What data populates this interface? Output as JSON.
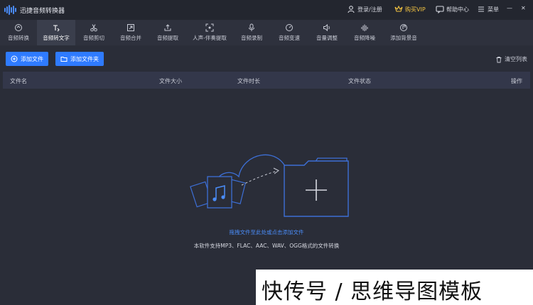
{
  "app": {
    "title": "迅捷音频转换器"
  },
  "titlebar": {
    "login": "登录/注册",
    "vip": "购买VIP",
    "help": "帮助中心",
    "menu": "菜单",
    "minimize": "—",
    "close": "✕"
  },
  "tabs": [
    {
      "label": "音频转换",
      "icon": "refresh-icon"
    },
    {
      "label": "音频转文字",
      "icon": "audio-to-text-icon"
    },
    {
      "label": "音频剪切",
      "icon": "scissors-icon"
    },
    {
      "label": "音频合并",
      "icon": "merge-icon"
    },
    {
      "label": "音频提取",
      "icon": "upload-icon"
    },
    {
      "label": "人声-伴奏提取",
      "icon": "voice-extract-icon"
    },
    {
      "label": "音频录制",
      "icon": "microphone-icon"
    },
    {
      "label": "音频变速",
      "icon": "speed-icon"
    },
    {
      "label": "音量调整",
      "icon": "volume-icon"
    },
    {
      "label": "音频降噪",
      "icon": "denoise-icon"
    },
    {
      "label": "添加背景音",
      "icon": "background-music-icon"
    }
  ],
  "actions": {
    "add_file": "添加文件",
    "add_folder": "添加文件夹",
    "clear_list": "清空列表"
  },
  "table": {
    "columns": [
      "文件名",
      "文件大小",
      "文件时长",
      "文件状态",
      "操作"
    ]
  },
  "drop": {
    "hint": "拖拽文件至此处或点击添加文件",
    "support": "本软件支持MP3、FLAC、AAC、WAV、OGG格式的文件转换"
  },
  "watermark": "快传号 / 思维导图模板",
  "colors": {
    "accent": "#2f7bff",
    "vip": "#f5c542",
    "background": "#2a2d38"
  }
}
